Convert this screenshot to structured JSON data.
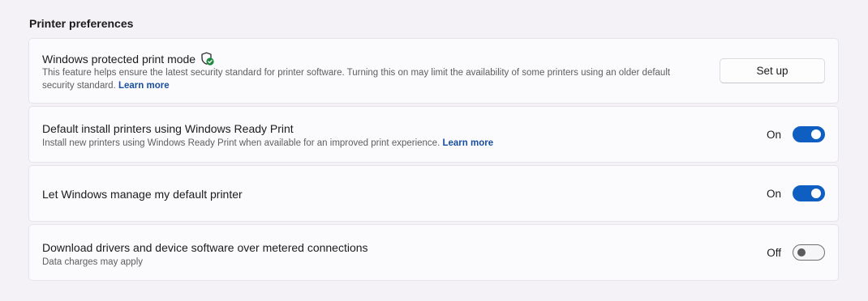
{
  "section_title": "Printer preferences",
  "protected_print": {
    "title": "Windows protected print mode",
    "icon": "shield-check-icon",
    "description": "This feature helps ensure the latest security standard for printer software. Turning this on may limit the availability of some printers using an older default security standard.",
    "link": "Learn more",
    "button_label": "Set up"
  },
  "ready_print": {
    "title": "Default install printers using Windows Ready Print",
    "description": "Install new printers using Windows Ready Print when available for an improved print experience.",
    "link": "Learn more",
    "state_label": "On",
    "enabled": true
  },
  "default_printer": {
    "title": "Let Windows manage my default printer",
    "state_label": "On",
    "enabled": true
  },
  "metered": {
    "title": "Download drivers and device software over metered connections",
    "description": "Data charges may apply",
    "state_label": "Off",
    "enabled": false
  },
  "colors": {
    "accent": "#0f5fc3",
    "link": "#1a4fa0",
    "shield_badge": "#1c8a3c"
  }
}
